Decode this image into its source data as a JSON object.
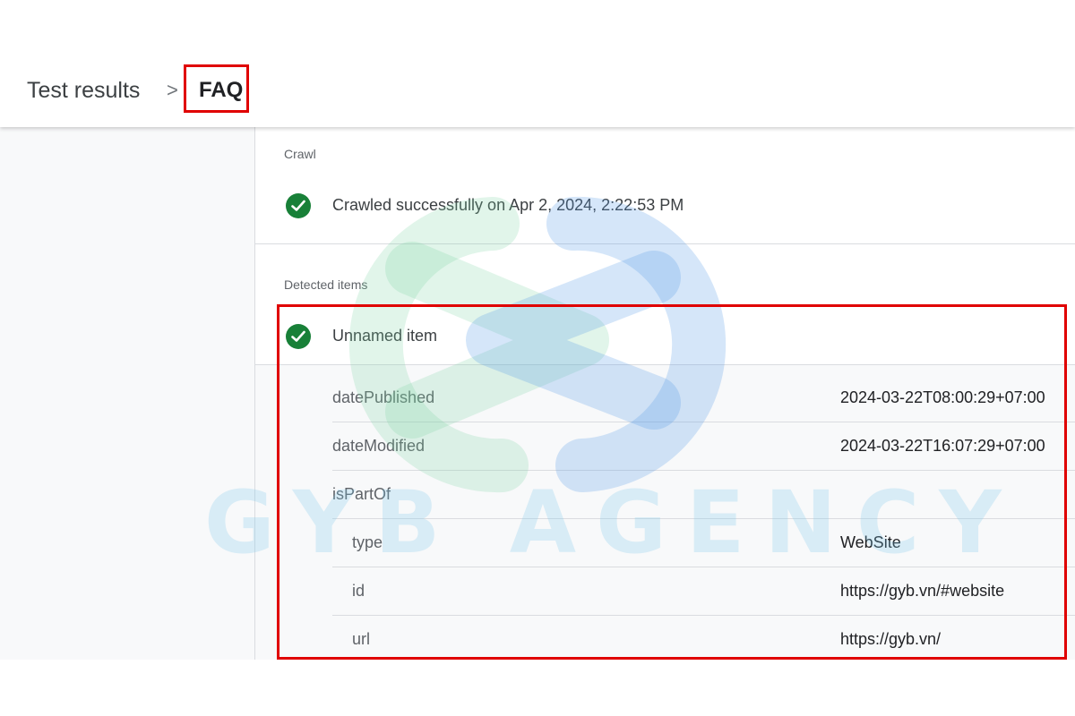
{
  "breadcrumb": {
    "root": "Test results",
    "separator": ">",
    "current": "FAQ"
  },
  "crawl": {
    "label": "Crawl",
    "status_icon": "check-circle-icon",
    "status_text": "Crawled successfully on Apr 2, 2024, 2:22:53 PM"
  },
  "detected": {
    "label": "Detected items",
    "status_icon": "check-circle-icon",
    "item_name": "Unnamed item"
  },
  "properties": [
    {
      "key": "datePublished",
      "value": "2024-03-22T08:00:29+07:00"
    },
    {
      "key": "dateModified",
      "value": "2024-03-22T16:07:29+07:00"
    },
    {
      "key": "isPartOf",
      "value": ""
    },
    {
      "key": "type",
      "value": "WebSite"
    },
    {
      "key": "id",
      "value": "https://gyb.vn/#website"
    },
    {
      "key": "url",
      "value": "https://gyb.vn/"
    }
  ],
  "watermark": {
    "text": "GYB AGENCY"
  },
  "colors": {
    "success": "#188038",
    "highlight": "#e00000"
  }
}
